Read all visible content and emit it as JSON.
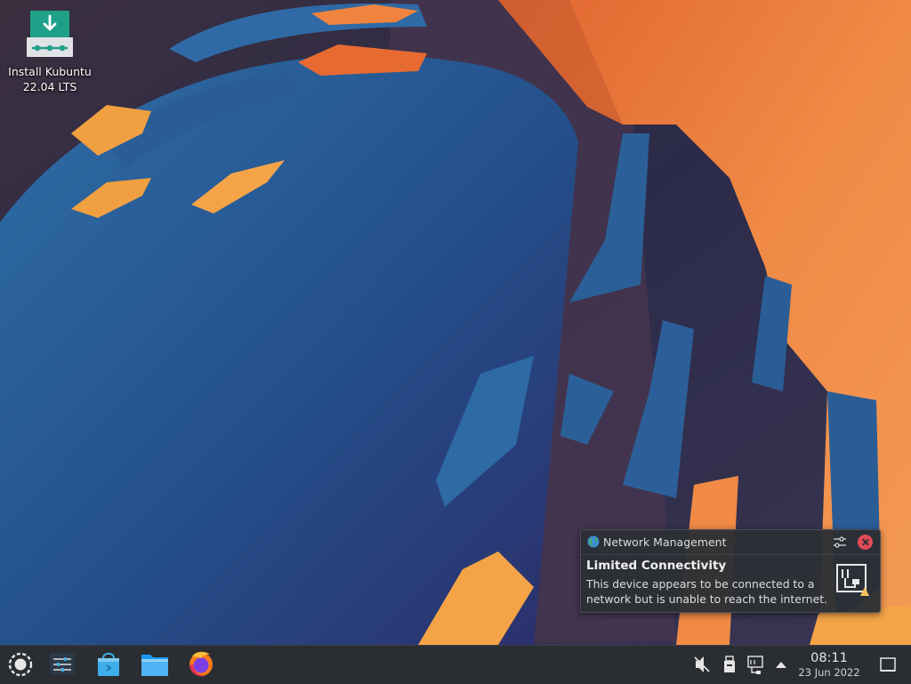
{
  "desktop": {
    "icons": [
      {
        "label_line1": "Install Kubuntu",
        "label_line2": "22.04 LTS",
        "icon": "kubuntu-installer-icon"
      }
    ]
  },
  "notification": {
    "app_name": "Network Management",
    "app_icon": "globe-icon",
    "title": "Limited Connectivity",
    "body_line1": "This device appears to be connected to a",
    "body_line2": "network but is unable to reach the internet.",
    "icons": [
      "configure-icon",
      "close-icon",
      "network-wired-warning-icon"
    ]
  },
  "taskbar": {
    "launchers": [
      {
        "name": "application-launcher",
        "icon": "kde-logo-icon"
      },
      {
        "name": "system-settings",
        "icon": "settings-sliders-icon"
      },
      {
        "name": "discover",
        "icon": "shopping-bag-icon"
      },
      {
        "name": "dolphin",
        "icon": "folder-icon"
      },
      {
        "name": "firefox",
        "icon": "firefox-icon"
      }
    ],
    "tray": [
      "volume-muted-icon",
      "removable-device-icon",
      "network-icon",
      "expand-arrow-icon"
    ],
    "clock": {
      "time": "08:11",
      "date": "23 Jun 2022"
    },
    "show_desktop_icon": "show-desktop-icon"
  },
  "colors": {
    "taskbar_bg": "#2a2e32",
    "notification_bg": "#2c2f34",
    "close_red": "#e04b55",
    "wallpaper_orange": "#f0843f",
    "wallpaper_blue": "#2a5d96"
  }
}
